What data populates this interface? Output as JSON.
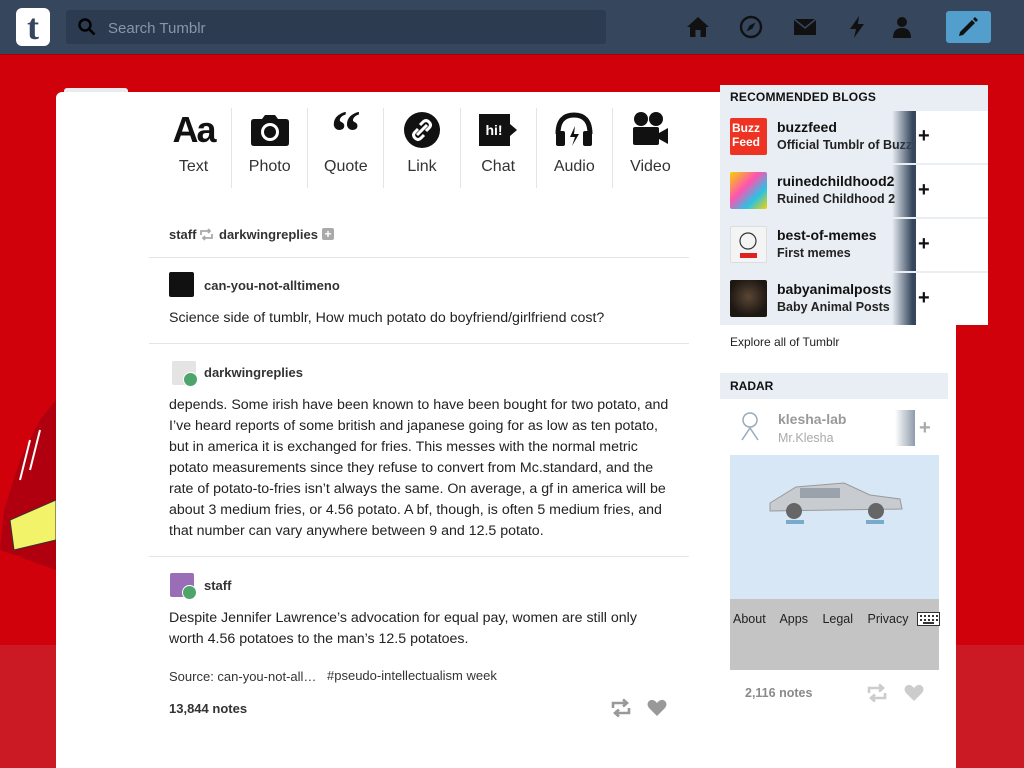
{
  "nav": {
    "search_placeholder": "Search Tumblr",
    "icons": [
      "home-icon",
      "explore-icon",
      "inbox-icon",
      "activity-icon",
      "account-icon",
      "compose-icon"
    ]
  },
  "post_types": [
    {
      "label": "Text",
      "icon": "text-icon"
    },
    {
      "label": "Photo",
      "icon": "camera-icon"
    },
    {
      "label": "Quote",
      "icon": "quote-icon"
    },
    {
      "label": "Link",
      "icon": "link-icon"
    },
    {
      "label": "Chat",
      "icon": "chat-icon",
      "badge": "hi!"
    },
    {
      "label": "Audio",
      "icon": "headphones-icon"
    },
    {
      "label": "Video",
      "icon": "video-camera-icon"
    }
  ],
  "post": {
    "reblogger": "staff",
    "source_blog": "darkwingreplies",
    "entries": [
      {
        "blog": "can-you-not-alltimeno",
        "text": "Science side of tumblr, How much potato do boyfriend/girlfriend cost?"
      },
      {
        "blog": "darkwingreplies",
        "text": "depends. Some irish have been known to have been bought for two potato, and I’ve heard reports of some british and japanese going for as low as ten potato, but in america it is exchanged for fries. This messes with the normal metric potato measurements since they refuse to convert from Mc.standard, and the rate of potato-to-fries isn’t always the same. On average, a gf in america will be about 3 medium fries, or 4.56 potato. A bf, though, is often 5 medium fries, and that number can vary anywhere between 9 and 12.5 potato."
      },
      {
        "blog": "staff",
        "text": "Despite Jennifer Lawrence’s advocation for equal pay, women are still only worth 4.56 potatoes to the man’s 12.5 potatoes."
      }
    ],
    "source": "Source: can-you-not-all…",
    "tag": "#pseudo-intellectualism week",
    "notes": "13,844 notes"
  },
  "recommended": {
    "title": "RECOMMENDED BLOGS",
    "blogs": [
      {
        "name": "buzzfeed",
        "subtitle": "Official Tumblr of BuzzFeed"
      },
      {
        "name": "ruinedchildhood2",
        "subtitle": "Ruined Childhood 2"
      },
      {
        "name": "best-of-memes",
        "subtitle": "First memes"
      },
      {
        "name": "babyanimalposts",
        "subtitle": "Baby Animal Posts"
      }
    ],
    "explore": "Explore all of Tumblr"
  },
  "radar": {
    "title": "RADAR",
    "blog": "klesha-lab",
    "subtitle": "Mr.Klesha",
    "notes": "2,116 notes"
  },
  "footer": [
    "About",
    "Apps",
    "Legal",
    "Privacy"
  ],
  "colors": {
    "background": "#d0010a",
    "nav": "#36465d",
    "compose": "#529ecc"
  }
}
